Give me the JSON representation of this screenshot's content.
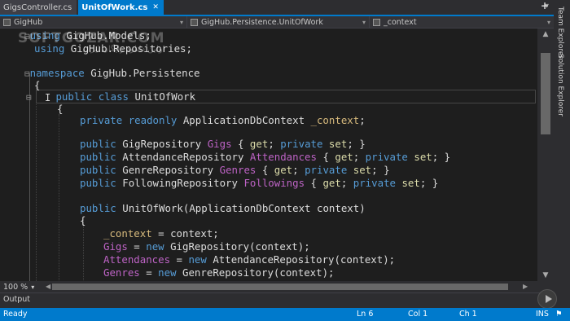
{
  "tabs": [
    {
      "label": "GigsController.cs",
      "active": false
    },
    {
      "label": "UnitOfWork.cs",
      "active": true
    }
  ],
  "navbar": {
    "project": "GigHub",
    "type": "GigHub.Persistence.UnitOfWork",
    "member": "_context"
  },
  "watermark": {
    "brand": "SOFTGOZAR.COM",
    "tagline": "اولین دانلود رایگان ایران"
  },
  "code": {
    "l1_kw": "using",
    "l1_rest": "GigHub.Models;",
    "l2_kw": "using",
    "l2_rest": "GigHub.Repositories;",
    "ns_kw": "namespace",
    "ns_name": "GigHub.Persistence",
    "brace_open": "{",
    "cls_kw1": "public",
    "cls_kw2": "class",
    "cls_name": "UnitOfWork",
    "ctx_kw1": "private",
    "ctx_kw2": "readonly",
    "ctx_type": "ApplicationDbContext",
    "ctx_field": "_context",
    "p_kw": "public",
    "get": "get",
    "private": "private",
    "set": "set",
    "p1_type": "GigRepository",
    "p1_name": "Gigs",
    "p2_type": "AttendanceRepository",
    "p2_name": "Attendances",
    "p3_type": "GenreRepository",
    "p3_name": "Genres",
    "p4_type": "FollowingRepository",
    "p4_name": "Followings",
    "ctor_name": "UnitOfWork",
    "ctor_param_type": "ApplicationDbContext",
    "ctor_param": "context",
    "a1_lhs": "_context",
    "a1_rhs": "context",
    "a2_lhs": "Gigs",
    "a2_new": "new",
    "a2_type": "GigRepository",
    "a3_lhs": "Attendances",
    "a3_new": "new",
    "a3_type": "AttendanceRepository",
    "a4_lhs": "Genres",
    "a4_new": "new",
    "a4_type": "GenreRepository"
  },
  "zoom": "100 %",
  "output_label": "Output",
  "side_tabs": [
    "Team Explorer",
    "Solution Explorer"
  ],
  "status": {
    "state": "Ready",
    "line": "Ln 6",
    "col": "Col 1",
    "ch": "Ch 1",
    "mode": "INS"
  }
}
